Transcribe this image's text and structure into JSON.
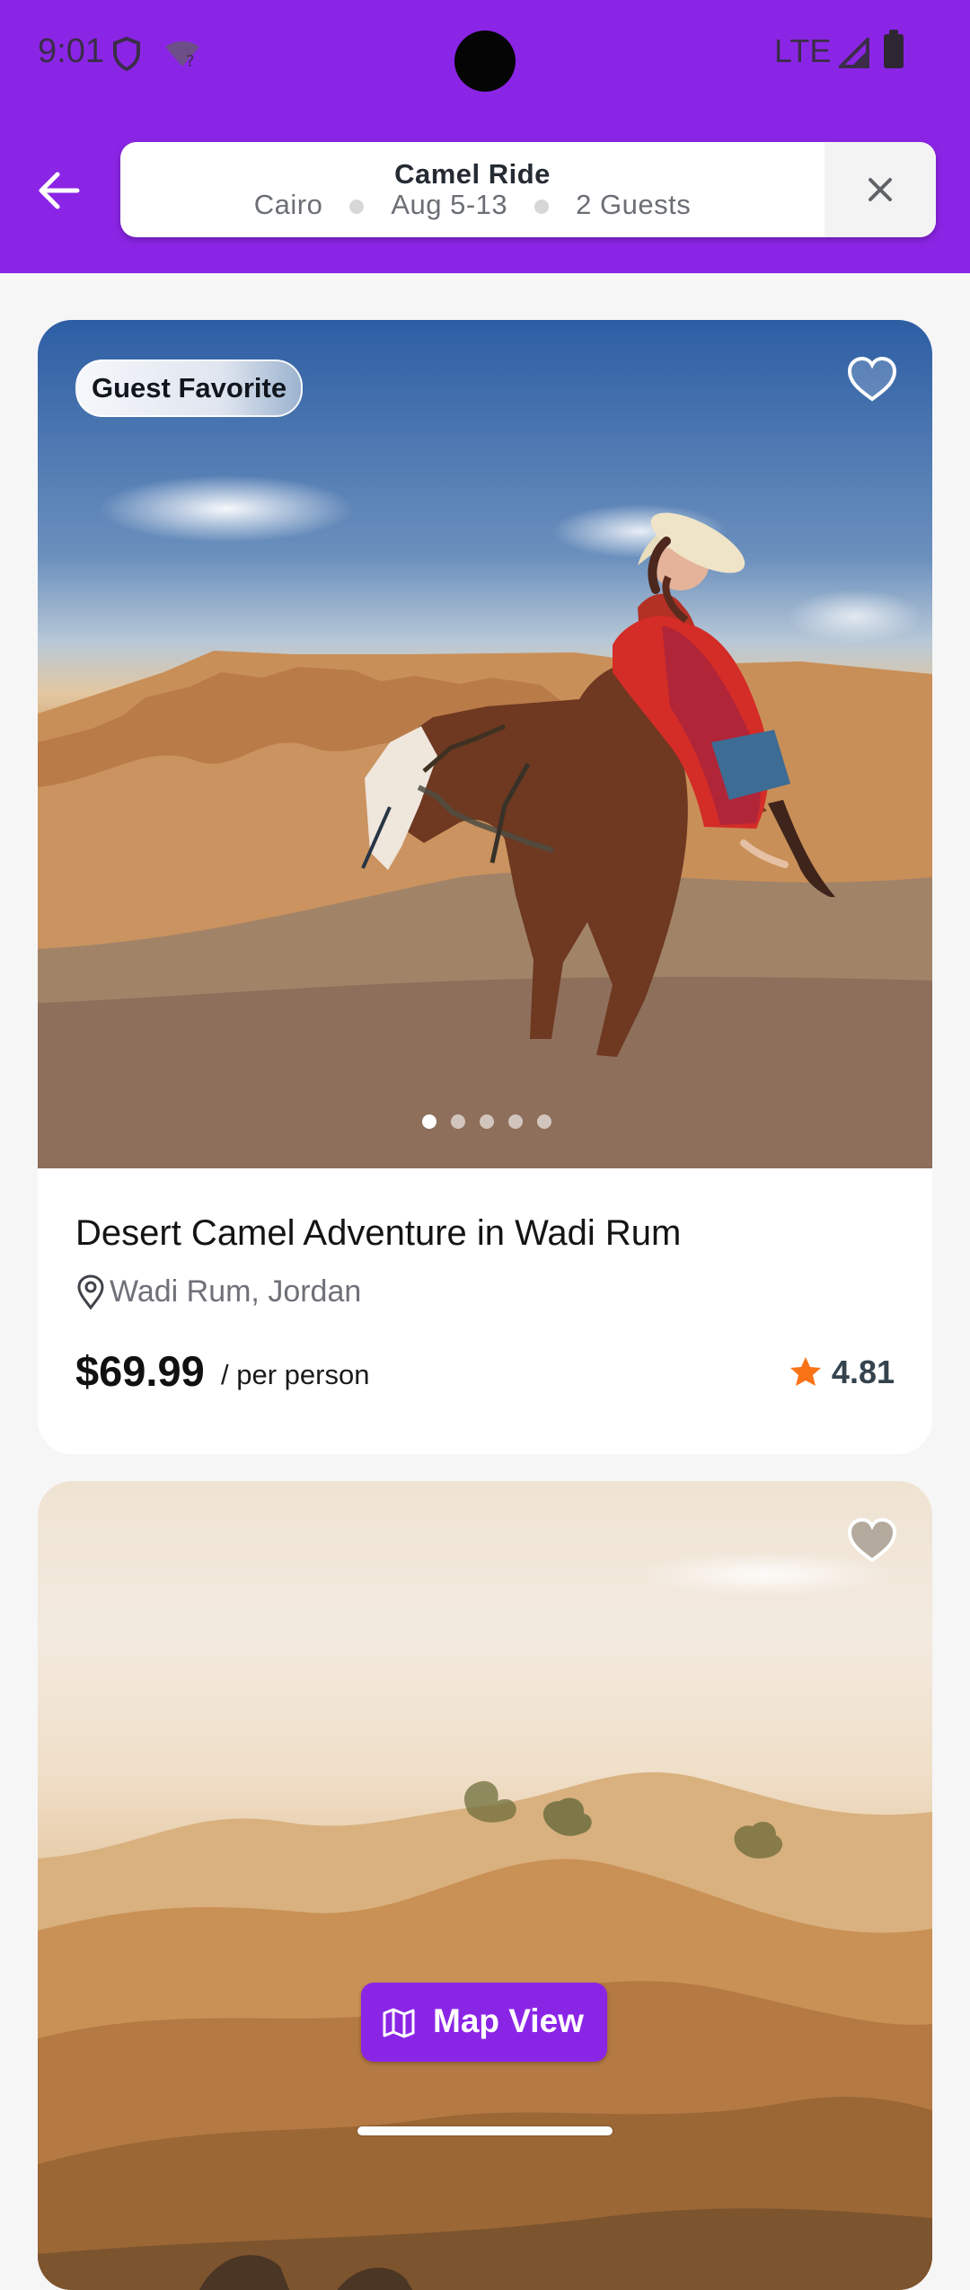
{
  "status_bar": {
    "time": "9:01",
    "network": "LTE",
    "icons": [
      "shield-icon",
      "wifi-icon",
      "signal-icon",
      "battery-icon"
    ]
  },
  "header": {
    "back_icon": "back-arrow-icon",
    "search": {
      "title": "Camel Ride",
      "location": "Cairo",
      "dates": "Aug 5-13",
      "guests": "2 Guests"
    },
    "clear_icon": "close-icon"
  },
  "listings": [
    {
      "badge": "Guest Favorite",
      "title": "Desert Camel Adventure in Wadi Rum",
      "location": "Wadi Rum, Jordan",
      "price": "$69.99",
      "price_unit": "/ per person",
      "rating": "4.81",
      "favorite_icon": "heart-icon",
      "image_dots": 5,
      "active_dot": 1
    },
    {
      "favorite_icon": "heart-icon"
    }
  ],
  "map_button": {
    "label": "Map View",
    "icon": "map-icon"
  },
  "colors": {
    "brand": "#8B25E6",
    "rating_star": "#F97316",
    "surface": "#FFFFFF"
  }
}
